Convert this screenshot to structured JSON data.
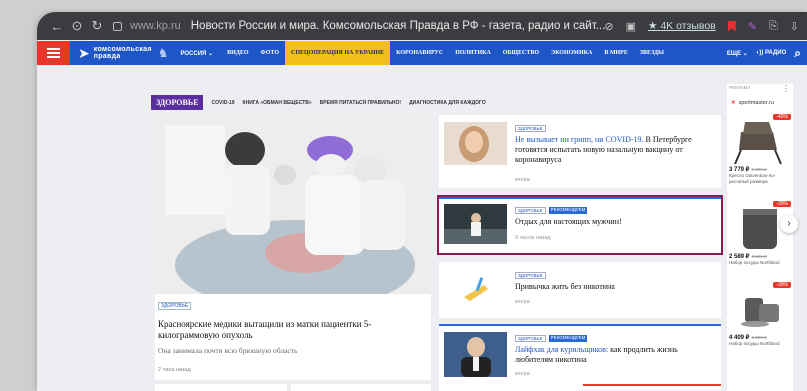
{
  "browser": {
    "domain": "www.kp.ru",
    "page_title": "Новости России и мира. Комсомольская Правда в РФ - газета, радио и сайт...",
    "reviews": "4K отзывов"
  },
  "nav": {
    "logo_line1": "комсомольская",
    "logo_line2": "правда",
    "region": "РОССИЯ",
    "menu": [
      "ВИДЕО",
      "ФОТО",
      "СПЕЦОПЕРАЦИЯ НА УКРАИНЕ",
      "КОРОНАВИРУС",
      "ПОЛИТИКА",
      "ОБЩЕСТВО",
      "ЭКОНОМИКА",
      "В МИРЕ",
      "ЗВЕЗДЫ"
    ],
    "more": "ЕЩЕ",
    "radio": "РАДИО"
  },
  "section": {
    "title": "ЗДОРОВЬЕ",
    "subnav": [
      "COVID-19",
      "КНИГА «ОБМАН ВЕЩЕСТВ»",
      "ВРЕМЯ ПИТАТЬСЯ ПРАВИЛЬНО!",
      "ДИАГНОСТИКА ДЛЯ КАЖДОГО"
    ]
  },
  "feature": {
    "badge": "ЗДОРОВЬЕ",
    "title": "Красноярские медики вытащили из матки пациентки 5-килограммовую опухоль",
    "lead": "Она занимала почти всю брюшную область",
    "time": "2 часа назад"
  },
  "cards": [
    {
      "badge": "ЗДОРОВЬЕ",
      "title": "Не вызывает ни грипп, ни COVID-19. В Петербурге готовятся испытать новую назальную вакцину от коронавируса",
      "link_part": "Не вызывает ни грипп, ни COVID-19.",
      "time": "вчера"
    },
    {
      "badge": "ЗДОРОВЬЕ",
      "badge2": "РЕКОМЕНДУЕМ",
      "title": "Отдых для настоящих мужчин!",
      "time": "9 часов назад"
    },
    {
      "badge": "ЗДОРОВЬЕ",
      "title": "Привычка жить без никотина",
      "time": "вчера"
    },
    {
      "badge": "ЗДОРОВЬЕ",
      "badge2": "РЕКОМЕНДУЕМ",
      "title_link": "Лайфхак для курильщиков:",
      "title_rest": " как продлить жизнь любителям никотина",
      "time": "вчера"
    }
  ],
  "ad": {
    "label": "РЕКЛАМА",
    "brand": "sportmaster.ru",
    "items": [
      {
        "discount": "-40%",
        "price": "3 779 ₽",
        "old": "6 299 ₽",
        "name": "Кресло Outventure Ко-ресчатый размера"
      },
      {
        "discount": "-30%",
        "price": "2 589 ₽",
        "old": "3 699 ₽",
        "name": "Набор посуды Northland"
      },
      {
        "discount": "-30%",
        "price": "4 409 ₽",
        "old": "6 299 ₽",
        "name": "Набор посуды Northland"
      }
    ]
  },
  "colors": {
    "nav": "#1e55c7",
    "accent_red": "#e8362a",
    "section": "#5c2fa0",
    "highlight": "#f2c019",
    "selection": "#8d1a55"
  }
}
